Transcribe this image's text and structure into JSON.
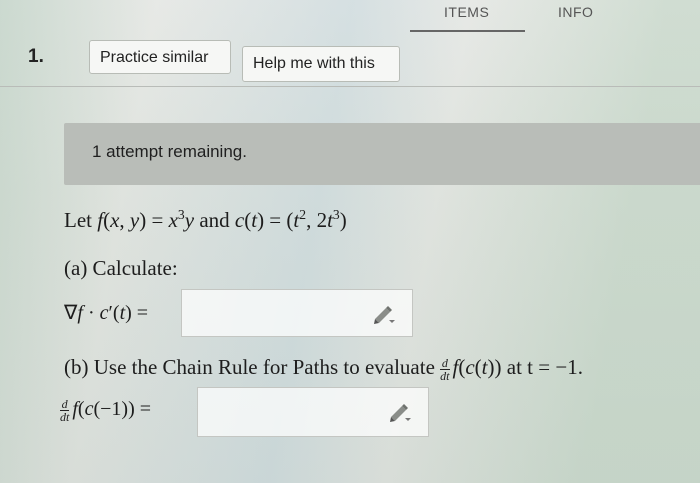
{
  "tabs": {
    "items": "ITEMS",
    "info": "INFO"
  },
  "question": {
    "number": "1.",
    "practice_label": "Practice similar",
    "help_label": "Help me with this",
    "attempts": "1 attempt remaining."
  },
  "problem": {
    "part_a": "(a) Calculate:",
    "part_b_intro": "(b) Use the Chain Rule for Paths to evaluate",
    "part_b_at": "at",
    "part_b_value": "t = −1."
  },
  "answers": {
    "a": "",
    "b": ""
  },
  "icons": {
    "edit": "pencil-icon"
  }
}
